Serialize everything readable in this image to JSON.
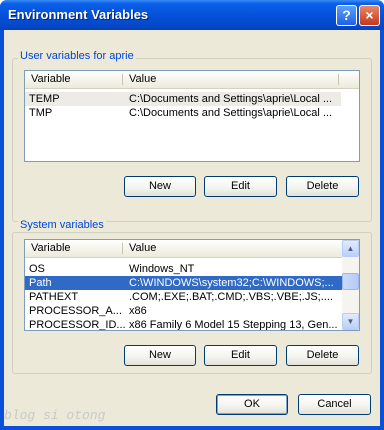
{
  "window": {
    "title": "Environment Variables",
    "help_glyph": "?",
    "close_glyph": "×"
  },
  "user_vars": {
    "group_label": "User variables for aprie",
    "columns": [
      "Variable",
      "Value"
    ],
    "rows": [
      {
        "name": "TEMP",
        "value": "C:\\Documents and Settings\\aprie\\Local ..."
      },
      {
        "name": "TMP",
        "value": "C:\\Documents and Settings\\aprie\\Local ..."
      }
    ],
    "buttons": {
      "new": "New",
      "edit": "Edit",
      "delete": "Delete"
    }
  },
  "system_vars": {
    "group_label": "System variables",
    "columns": [
      "Variable",
      "Value"
    ],
    "rows": [
      {
        "name": "OS",
        "value": "Windows_NT"
      },
      {
        "name": "Path",
        "value": "C:\\WINDOWS\\system32;C:\\WINDOWS;..."
      },
      {
        "name": "PATHEXT",
        "value": ".COM;.EXE;.BAT;.CMD;.VBS;.VBE;.JS;...."
      },
      {
        "name": "PROCESSOR_A...",
        "value": "x86"
      },
      {
        "name": "PROCESSOR_ID...",
        "value": "x86 Family 6 Model 15 Stepping 13, Gen..."
      }
    ],
    "buttons": {
      "new": "New",
      "edit": "Edit",
      "delete": "Delete"
    }
  },
  "footer": {
    "ok": "OK",
    "cancel": "Cancel"
  },
  "watermark": "blog si otong"
}
